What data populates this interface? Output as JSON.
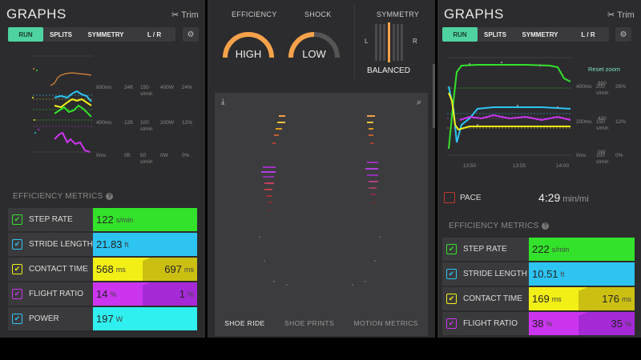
{
  "left": {
    "title": "GRAPHS",
    "trim_label": "Trim",
    "tabs": [
      {
        "label": "RUN",
        "active": true
      },
      {
        "label": "SPLITS",
        "active": false
      },
      {
        "label": "SYMMETRY",
        "active": false
      },
      {
        "label": "L / R",
        "active": false
      }
    ],
    "axis_ticks": {
      "col1": [
        "800ms",
        "400ms",
        "0ms"
      ],
      "col2": [
        "24ft",
        "12ft",
        "0ft"
      ],
      "col3": [
        "150",
        "100",
        "50"
      ],
      "col3_unit": "s/min",
      "col4": [
        "400W",
        "200W",
        "0W"
      ],
      "col5": [
        "24%",
        "12%",
        "0%"
      ]
    },
    "section_label": "EFFICIENCY METRICS",
    "metrics": [
      {
        "name": "STEP RATE",
        "value": "122",
        "unit": "s/min"
      },
      {
        "name": "STRIDE LENGTH",
        "value": "21.83",
        "unit": "ft"
      },
      {
        "name": "CONTACT TIME",
        "value": "568",
        "unit": "ms",
        "value_right": "697",
        "unit_right": "ms"
      },
      {
        "name": "FLIGHT RATIO",
        "value": "14",
        "unit": "%",
        "value_right": "1",
        "unit_right": "%"
      },
      {
        "name": "POWER",
        "value": "197",
        "unit": "W"
      }
    ]
  },
  "center": {
    "efficiency_label": "EFFICIENCY",
    "efficiency_value": "HIGH",
    "shock_label": "SHOCK",
    "shock_value": "LOW",
    "symmetry_label": "SYMMETRY",
    "symmetry_left": "L",
    "symmetry_right": "R",
    "symmetry_value": "BALANCED",
    "bottom_tabs": [
      {
        "label": "SHOE RIDE",
        "active": true
      },
      {
        "label": "SHOE PRINTS",
        "active": false
      },
      {
        "label": "MOTION METRICS",
        "active": false
      }
    ]
  },
  "right": {
    "title": "GRAPHS",
    "trim_label": "Trim",
    "tabs": [
      {
        "label": "RUN",
        "active": true
      },
      {
        "label": "SPLITS",
        "active": false
      },
      {
        "label": "SYMMETRY",
        "active": false
      },
      {
        "label": "L / R",
        "active": false
      }
    ],
    "reset_zoom": "Reset zoom",
    "axis_ticks": {
      "col1": [
        "400ms",
        "200ms",
        "0ms"
      ],
      "col2": [
        "200",
        "150",
        "100"
      ],
      "col2_unit": "s/min",
      "col3": [
        "800",
        "400",
        "0W"
      ],
      "col4": [
        "26%",
        "12%",
        "0%"
      ],
      "x": [
        "13:50",
        "13:55",
        "14:00"
      ]
    },
    "pace_label": "PACE",
    "pace_value": "4:29",
    "pace_unit": "min/mi",
    "section_label": "EFFICIENCY METRICS",
    "metrics": [
      {
        "name": "STEP RATE",
        "value": "222",
        "unit": "s/min"
      },
      {
        "name": "STRIDE LENGTH",
        "value": "10.51",
        "unit": "ft"
      },
      {
        "name": "CONTACT TIME",
        "value": "169",
        "unit": "ms",
        "value_right": "176",
        "unit_right": "ms"
      },
      {
        "name": "FLIGHT RATIO",
        "value": "38",
        "unit": "%",
        "value_right": "35",
        "unit_right": "%"
      }
    ]
  },
  "colors": {
    "green": "#33e22a",
    "blue": "#2ec4f2",
    "yellow": "#f2ef16",
    "yellow_dark": "#cbc012",
    "purple": "#cc35f0",
    "purple_dark": "#a52ad6",
    "cyan": "#2ff0ee",
    "orange": "#f5a24a",
    "accent": "#4fd3a0"
  }
}
